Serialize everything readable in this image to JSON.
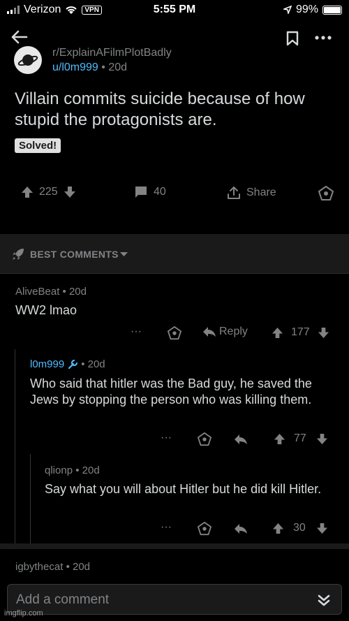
{
  "status": {
    "carrier": "Verizon",
    "vpn": "VPN",
    "time": "5:55 PM",
    "battery": "99%",
    "battery_level": 0.99
  },
  "post": {
    "subreddit": "r/ExplainAFilmPlotBadly",
    "author": "u/l0m999",
    "age": "• 20d",
    "title": "Villain commits suicide because of how stupid the protagonists are.",
    "flair": "Solved!",
    "upvotes": "225",
    "comments": "40",
    "share": "Share"
  },
  "sort": {
    "label": "BEST COMMENTS"
  },
  "comments": [
    {
      "author": "AliveBeat",
      "age": "• 20d",
      "body": "WW2 lmao",
      "more": "···",
      "reply": "Reply",
      "score": "177"
    },
    {
      "author": "l0m999",
      "age": "• 20d",
      "body": "Who said that hitler was the Bad guy, he saved the Jews by stopping the person who was killing them.",
      "more": "···",
      "score": "77"
    },
    {
      "author": "qlionp",
      "age": "• 20d",
      "body": "Say what you will about Hitler but he did kill Hitler.",
      "more": "···",
      "score": "30"
    }
  ],
  "next_comment": {
    "author": "igbythecat",
    "age": "• 20d"
  },
  "composer": {
    "placeholder": "Add a comment"
  },
  "watermark": "imgflip.com",
  "icons": [
    "back-arrow-icon",
    "bookmark-icon",
    "more-icon",
    "planet-icon",
    "upvote-icon",
    "downvote-icon",
    "comment-icon",
    "share-icon",
    "award-icon",
    "rocket-icon",
    "chevron-down-icon",
    "reply-icon",
    "mod-wrench-icon",
    "collapse-icon"
  ]
}
